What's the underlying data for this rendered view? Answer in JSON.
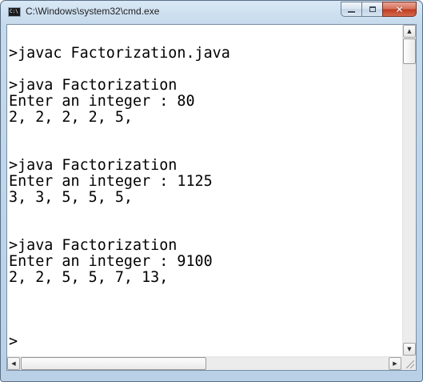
{
  "window": {
    "title": "C:\\Windows\\system32\\cmd.exe",
    "icon": "cmd-console-icon",
    "icon_label": "C:\\",
    "buttons": {
      "minimize": "minimize-icon",
      "maximize": "maximize-icon",
      "close": "close-icon",
      "close_glyph": "✕"
    }
  },
  "console": {
    "text": "\n>javac Factorization.java\n\n>java Factorization\nEnter an integer : 80\n2, 2, 2, 2, 5,\n\n\n>java Factorization\nEnter an integer : 1125\n3, 3, 5, 5, 5,\n\n\n>java Factorization\nEnter an integer : 9100\n2, 2, 5, 5, 7, 13,\n\n\n\n>"
  },
  "scrollbars": {
    "up_arrow": "▲",
    "down_arrow": "▼",
    "left_arrow": "◀",
    "right_arrow": "▶"
  },
  "colors": {
    "console_background": "#ffffff",
    "console_text": "#000000",
    "close_button": "#c8452c"
  }
}
